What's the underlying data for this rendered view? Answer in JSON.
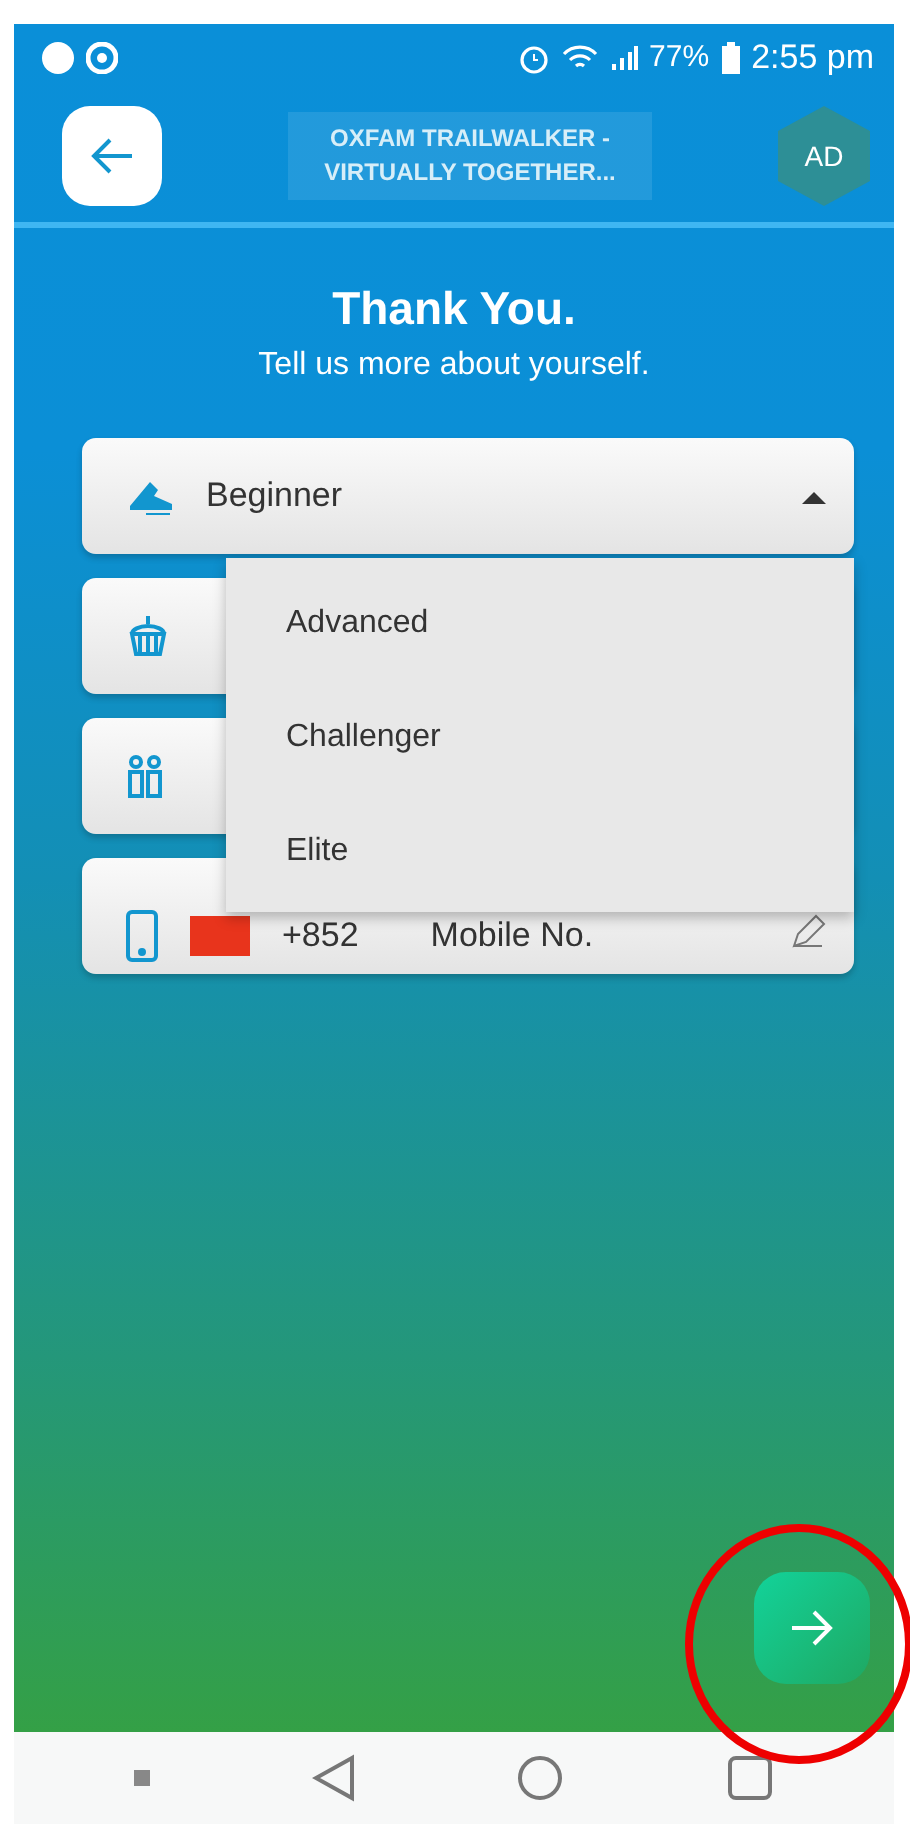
{
  "status_bar": {
    "battery": "77%",
    "time": "2:55 pm"
  },
  "header": {
    "title": "OXFAM TRAILWALKER -\nVIRTUALLY TOGETHER...",
    "avatar": "AD"
  },
  "heading": {
    "title": "Thank You.",
    "subtitle": "Tell us more about yourself."
  },
  "level_select": {
    "value": "Beginner",
    "expanded": true,
    "options": [
      {
        "label": "Advanced",
        "selected": false
      },
      {
        "label": "Challenger",
        "selected": false
      },
      {
        "label": "Elite",
        "selected": false
      }
    ]
  },
  "mobile": {
    "code": "+852",
    "placeholder": "Mobile No."
  }
}
